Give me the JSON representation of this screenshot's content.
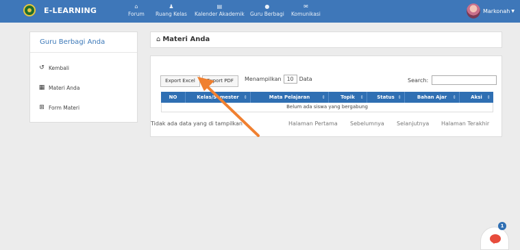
{
  "brand": {
    "name": "E-LEARNING"
  },
  "nav": [
    {
      "label": "Forum",
      "icon": "home-icon"
    },
    {
      "label": "Ruang Kelas",
      "icon": "class-icon"
    },
    {
      "label": "Kalender Akademik",
      "icon": "calendar-icon"
    },
    {
      "label": "Guru Berbagi",
      "icon": "user-icon"
    },
    {
      "label": "Komunikasi",
      "icon": "mail-icon"
    }
  ],
  "user": {
    "name": "Markonah"
  },
  "sidebar": {
    "title": "Guru Berbagi Anda",
    "items": [
      {
        "label": "Kembali",
        "icon": "back-icon"
      },
      {
        "label": "Materi Anda",
        "icon": "table-icon"
      },
      {
        "label": "Form Materi",
        "icon": "plus-box-icon"
      }
    ]
  },
  "main": {
    "title": "Materi Anda",
    "export_excel": "Export Excel",
    "export_pdf": "Export PDF",
    "show_prefix": "Menampilkan",
    "show_value": "10",
    "show_suffix": "Data",
    "search_label": "Search:",
    "columns": [
      "NO",
      "Kelas/Semester",
      "Mata Pelajaran",
      "Topik",
      "Status",
      "Bahan Ajar",
      "Aksi"
    ],
    "empty_message": "Belum ada siswa yang bergabung",
    "info": "Tidak ada data yang di tampilkan",
    "pagination": {
      "first": "Halaman Pertama",
      "prev": "Sebelumnya",
      "next": "Selanjutnya",
      "last": "Halaman Terakhir"
    }
  },
  "chat": {
    "badge": "1"
  },
  "colors": {
    "navbar": "#3e77b9",
    "table_header": "#2f6fb3",
    "arrow": "#f08030",
    "chat": "#e74c3c"
  }
}
